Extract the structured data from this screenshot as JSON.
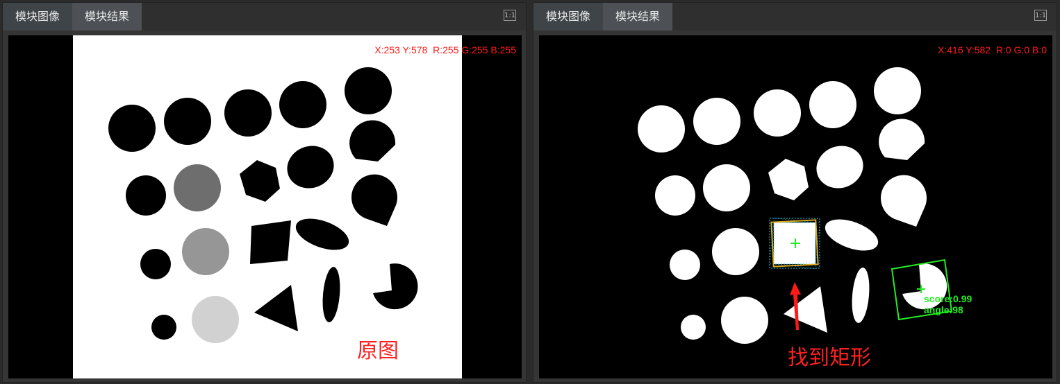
{
  "colors": {
    "readout": "#ff1a1a",
    "annotation": "#ff2020",
    "match_box": "#22ee22",
    "candidate_box": "#22ccee",
    "canvas": "#000000"
  },
  "left_panel": {
    "tabs": [
      {
        "label": "模块图像",
        "active": true
      },
      {
        "label": "模块结果",
        "active": false
      }
    ],
    "one_to_one_label": "1:1",
    "readout": "X:253 Y:578  R:255 G:255 B:255",
    "caption": "原图"
  },
  "right_panel": {
    "tabs": [
      {
        "label": "模块图像",
        "active": true
      },
      {
        "label": "模块结果",
        "active": false
      }
    ],
    "one_to_one_label": "1:1",
    "readout": "X:416 Y:582  R:0 G:0 B:0",
    "caption": "找到矩形",
    "match": {
      "score_text": "score:0.99",
      "angle_text": "angle:98"
    },
    "icons": [
      "arrow-up-icon",
      "crosshair-icon"
    ]
  }
}
